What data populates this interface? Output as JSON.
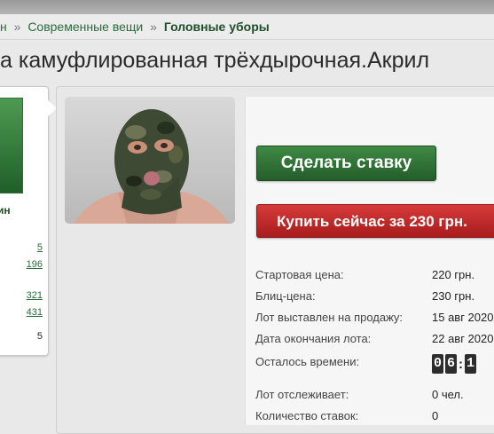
{
  "breadcrumb": {
    "items": [
      "н",
      "Современные вещи"
    ],
    "current": "Головные уборы",
    "separator": "»"
  },
  "title": "а камуфлированная трёхдырочная.Акрил",
  "seller": {
    "name": "кин",
    "stats": [
      "5",
      "196",
      "321",
      "431"
    ],
    "count": "5"
  },
  "photo": {
    "alt": "balaclava-photo"
  },
  "actions": {
    "bid_label": "Сделать ставку",
    "buy_label": "Купить сейчас за 230 грн."
  },
  "details": [
    {
      "label": "Стартовая цена:",
      "value": "220 грн."
    },
    {
      "label": "Блиц-цена:",
      "value": "230 грн."
    },
    {
      "label": "Лот выставлен на продажу:",
      "value": "15 авг 2020"
    },
    {
      "label": "Дата окончания лота:",
      "value": "22 авг 2020"
    },
    {
      "label": "Осталось времени:",
      "value": ""
    },
    {
      "label": "Лот отслеживает:",
      "value": "0 чел."
    },
    {
      "label": "Количество ставок:",
      "value": "0"
    }
  ],
  "timer": {
    "digits": [
      "0",
      "6",
      "1"
    ]
  },
  "colors": {
    "accent_green": "#245d2a",
    "buy_red": "#c62828",
    "link_green": "#2a6a3c"
  }
}
